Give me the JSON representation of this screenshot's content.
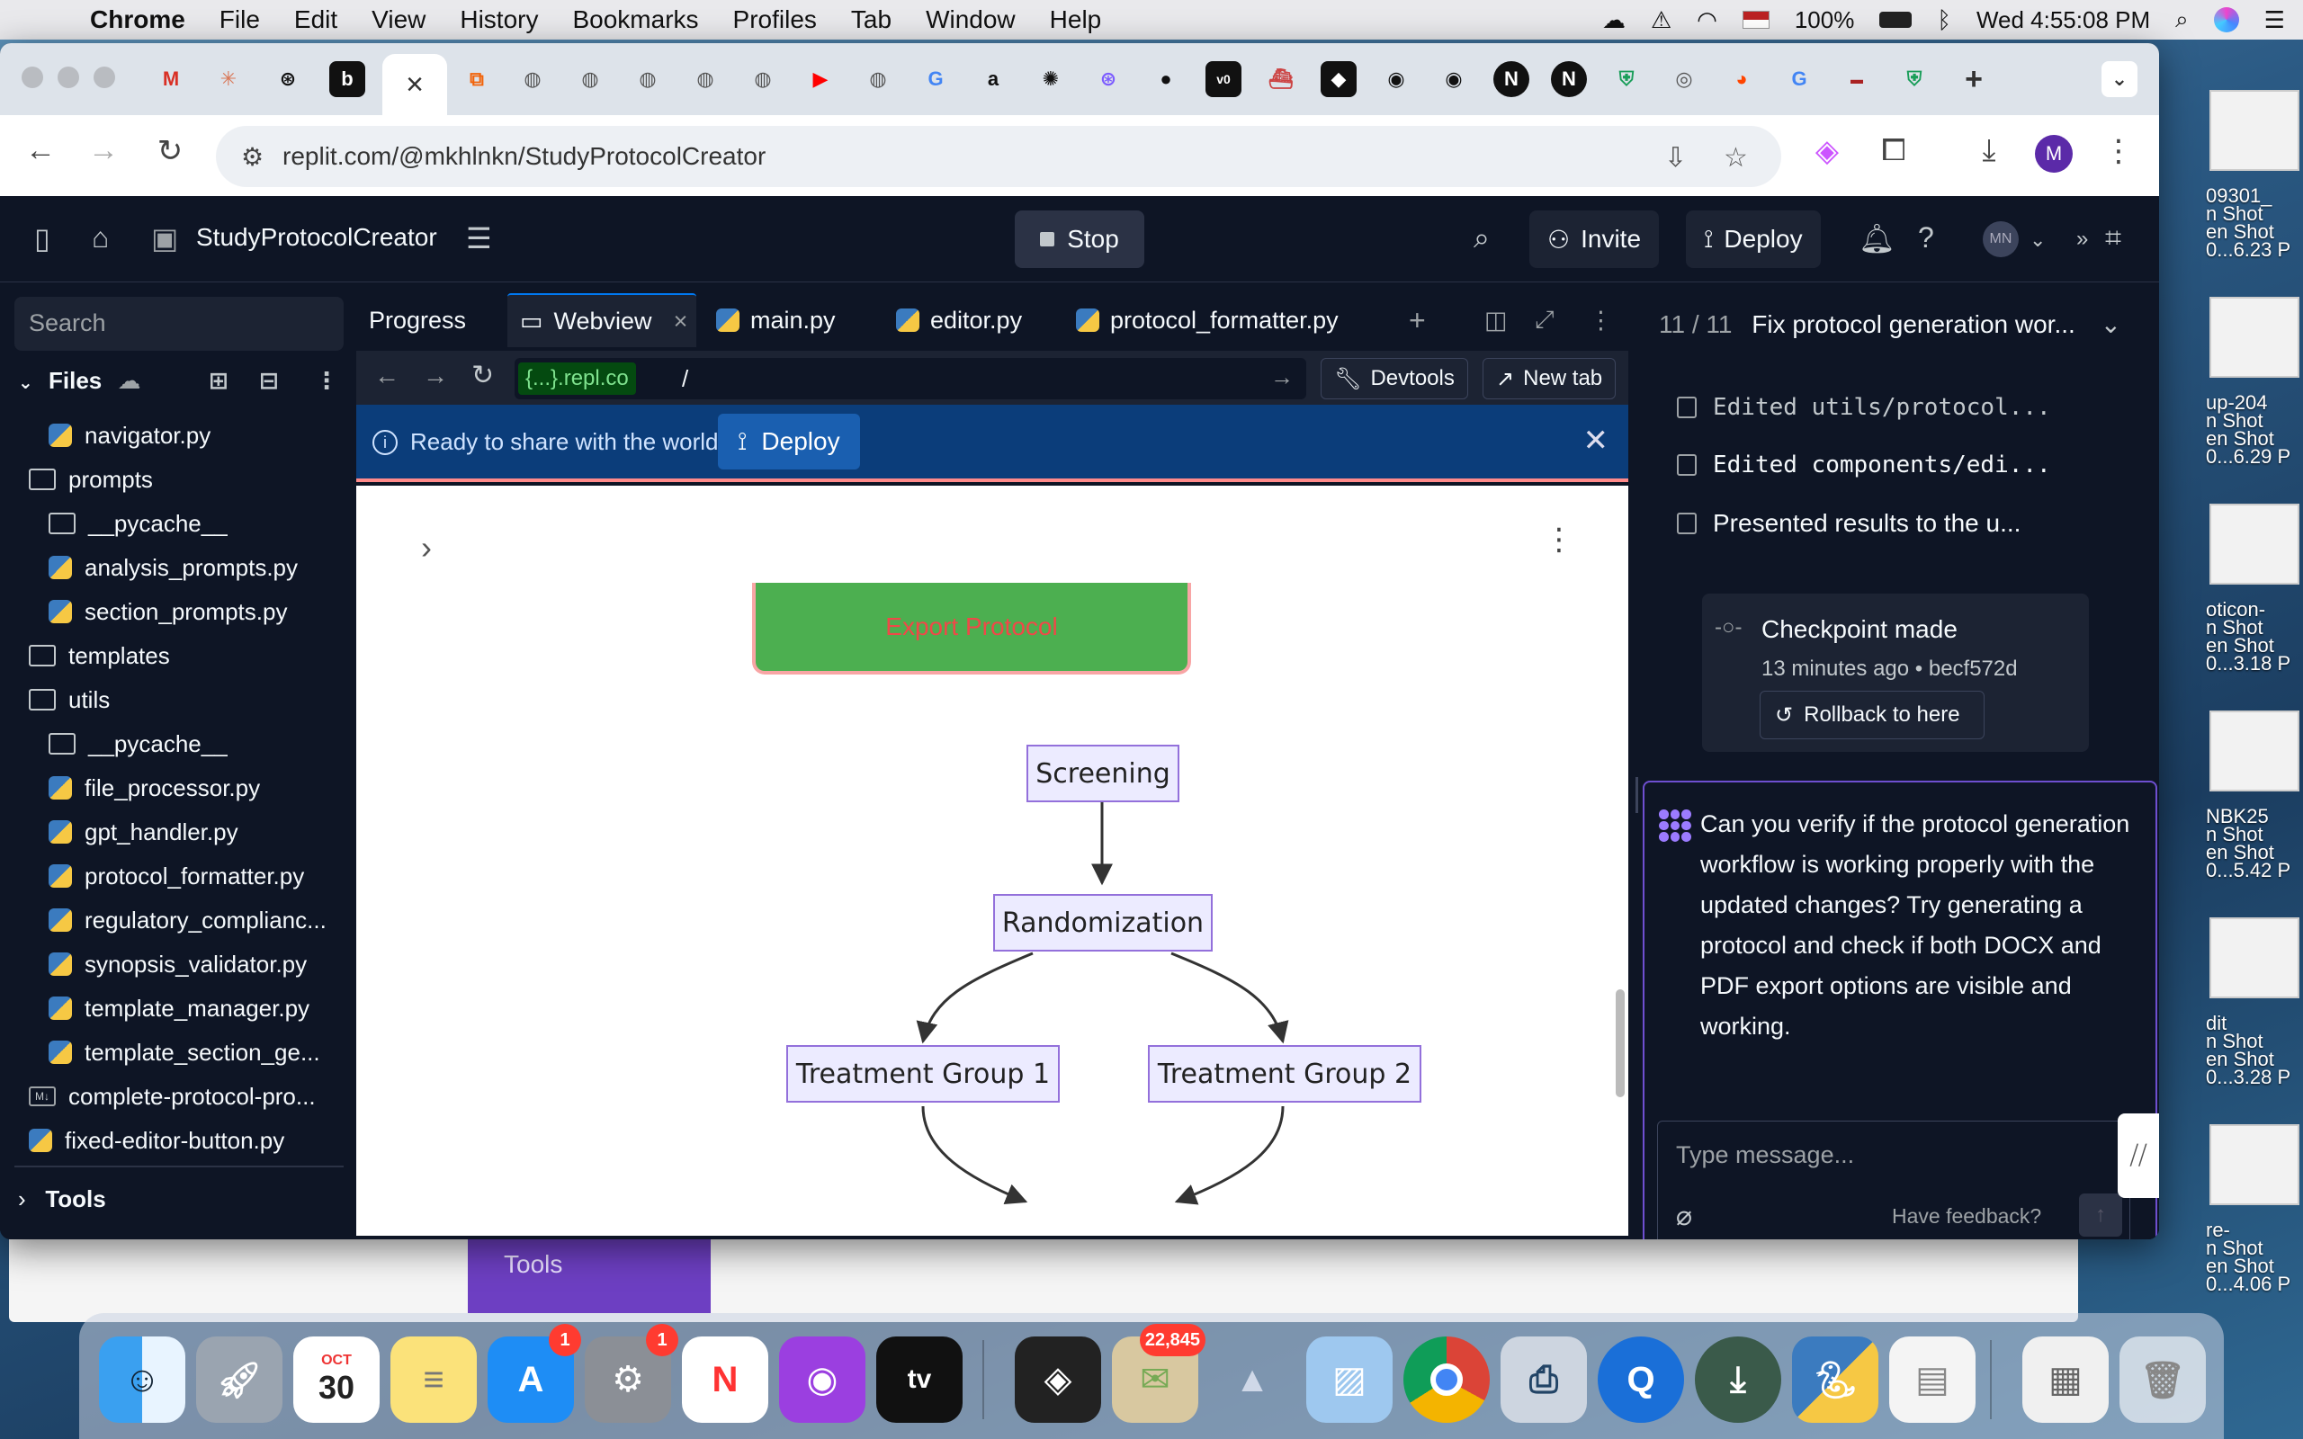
{
  "menubar": {
    "app": "Chrome",
    "items": [
      "File",
      "Edit",
      "View",
      "History",
      "Bookmarks",
      "Profiles",
      "Tab",
      "Window",
      "Help"
    ],
    "battery": "100%",
    "clock": "Wed 4:55:08 PM"
  },
  "browser": {
    "active_tab_close": "×",
    "url": "replit.com/@mkhlnkn/StudyProtocolCreator",
    "profile_initial": "M"
  },
  "topbar": {
    "project_name": "StudyProtocolCreator",
    "stop_label": "Stop",
    "invite_label": "Invite",
    "deploy_label": "Deploy",
    "avatar_initials": "MN"
  },
  "sidebar": {
    "search_placeholder": "Search",
    "files_header": "Files",
    "files": [
      {
        "name": "navigator.py",
        "type": "py",
        "indent": 1
      },
      {
        "name": "prompts",
        "type": "folder",
        "indent": 0
      },
      {
        "name": "__pycache__",
        "type": "folder",
        "indent": 1
      },
      {
        "name": "analysis_prompts.py",
        "type": "py",
        "indent": 1
      },
      {
        "name": "section_prompts.py",
        "type": "py",
        "indent": 1
      },
      {
        "name": "templates",
        "type": "folder",
        "indent": 0
      },
      {
        "name": "utils",
        "type": "folder",
        "indent": 0
      },
      {
        "name": "__pycache__",
        "type": "folder",
        "indent": 1
      },
      {
        "name": "file_processor.py",
        "type": "py",
        "indent": 1
      },
      {
        "name": "gpt_handler.py",
        "type": "py",
        "indent": 1
      },
      {
        "name": "protocol_formatter.py",
        "type": "py",
        "indent": 1
      },
      {
        "name": "regulatory_complianc...",
        "type": "py",
        "indent": 1
      },
      {
        "name": "synopsis_validator.py",
        "type": "py",
        "indent": 1
      },
      {
        "name": "template_manager.py",
        "type": "py",
        "indent": 1
      },
      {
        "name": "template_section_ge...",
        "type": "py",
        "indent": 1
      },
      {
        "name": "complete-protocol-pro...",
        "type": "md",
        "indent": 0
      },
      {
        "name": "fixed-editor-button.py",
        "type": "py",
        "indent": 0
      }
    ],
    "tools_label": "Tools"
  },
  "editor_tabs": {
    "progress": "Progress",
    "webview": "Webview",
    "main": "main.py",
    "editor": "editor.py",
    "formatter": "protocol_formatter.py"
  },
  "webview": {
    "repl_badge": "{...}.repl.co",
    "path": "/",
    "devtools": "Devtools",
    "new_tab": "New tab",
    "banner_text": "Ready to share with the world?",
    "banner_deploy": "Deploy",
    "export_button": "Export Protocol",
    "flow_nodes": {
      "screening": "Screening",
      "randomization": "Randomization",
      "group1": "Treatment Group 1",
      "group2": "Treatment Group 2"
    }
  },
  "agent": {
    "progress": "11 / 11",
    "title": "Fix protocol generation wor...",
    "items": [
      "Edited utils/protocol...",
      "Edited components/edi...",
      "Presented results to the u..."
    ],
    "checkpoint_title": "Checkpoint made",
    "checkpoint_meta": "13 minutes ago • becf572d",
    "rollback": "Rollback to here",
    "message": "Can you verify if the protocol generation workflow is working properly with the updated changes? Try generating a protocol and check if both DOCX and PDF export options are visible and working.",
    "input_placeholder": "Type message...",
    "feedback": "Have feedback?"
  },
  "background_window": {
    "tools_tab": "Tools"
  },
  "desktop": {
    "labels": [
      "09301_",
      "n Shot",
      "en Shot",
      "0...6.23 P",
      "up-204",
      "n Shot",
      "en Shot",
      "0...6.29 P",
      "oticon-",
      "n Shot",
      "en Shot",
      "0...3.18 P",
      "NBK25",
      "n Shot",
      "en Shot",
      "0...5.42 P",
      "dit",
      "n Shot",
      "en Shot",
      "0...3.28 P",
      "re-",
      "n Shot",
      "en Shot",
      "0...4.06 P"
    ]
  },
  "dock": {
    "calendar_month": "OCT",
    "calendar_day": "30",
    "appstore_badge": "1",
    "settings_badge": "1",
    "mail_badge": "22,845"
  },
  "colors": {
    "replit_bg": "#0e1525",
    "replit_panel": "#1c2333",
    "accent_blue": "#0079f2",
    "export_green": "#4caf50",
    "export_text": "#f04848",
    "node_fill": "#ecebff",
    "node_border": "#9370db",
    "chat_border": "#6e4fd0"
  }
}
